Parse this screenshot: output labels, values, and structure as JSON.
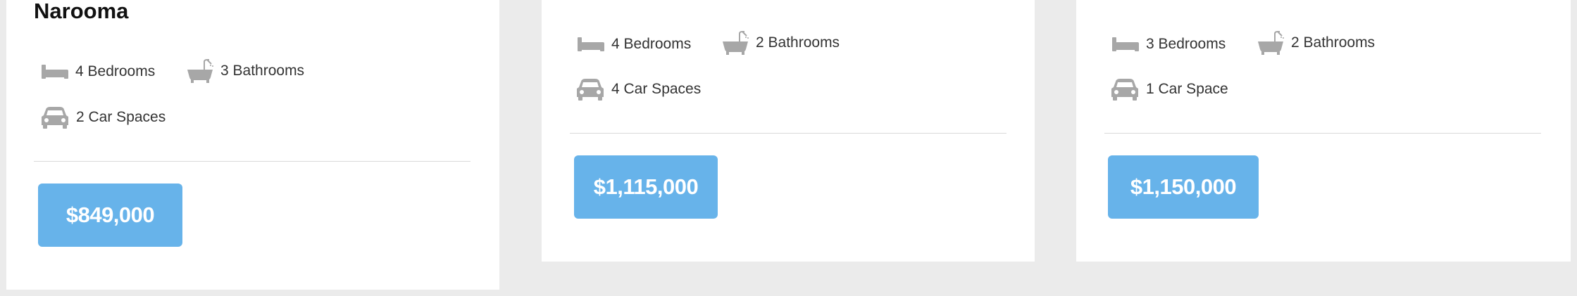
{
  "listings": [
    {
      "title": "Narooma",
      "bedrooms": "4 Bedrooms",
      "bathrooms": "3 Bathrooms",
      "car_spaces": "2 Car Spaces",
      "price": "$849,000"
    },
    {
      "bedrooms": "4 Bedrooms",
      "bathrooms": "2 Bathrooms",
      "car_spaces": "4 Car Spaces",
      "price": "$1,115,000"
    },
    {
      "bedrooms": "3 Bedrooms",
      "bathrooms": "2 Bathrooms",
      "car_spaces": "1 Car Space",
      "price": "$1,150,000"
    }
  ],
  "icons": {
    "bed": "bed-icon",
    "bath": "bathtub-icon",
    "car": "car-icon"
  },
  "colors": {
    "price_button": "#67b3ea",
    "icon": "#a7a7a7",
    "background": "#ebebeb"
  }
}
